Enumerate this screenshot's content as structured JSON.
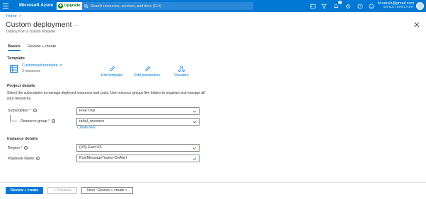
{
  "topbar": {
    "brand": "Microsoft Azure",
    "upgrade_label": "Upgrade",
    "search_placeholder": "Search resources, services, and docs (G+/)",
    "notification_count": "1",
    "user_email": "hi.rahulx@gmail.com",
    "user_directory": "DEFAULT DIRECTORY",
    "accent": "#0078d4"
  },
  "breadcrumb": {
    "home": "Home",
    "separator": ">"
  },
  "page": {
    "title": "Custom deployment",
    "more": "...",
    "subtitle": "Deploy from a custom template"
  },
  "tabs": [
    {
      "label": "Basics",
      "active": true
    },
    {
      "label": "Review + create",
      "active": false
    }
  ],
  "template": {
    "section_title": "Template",
    "link_text": "Customized template",
    "resource_count": "3 resources",
    "actions": [
      {
        "label": "Edit template",
        "icon": "pencil-icon"
      },
      {
        "label": "Edit parameters",
        "icon": "pencil-icon"
      },
      {
        "label": "Visualize",
        "icon": "visualize-icon"
      }
    ]
  },
  "project": {
    "section_title": "Project details",
    "description": "Select the subscription to manage deployed resources and costs. Use resource groups like folders to organize and manage all your resources.",
    "subscription_label": "Subscription",
    "subscription_value": "Free Trial",
    "resource_group_label": "Resource group",
    "resource_group_value": "rahul_resource",
    "create_new": "Create new"
  },
  "instance": {
    "section_title": "Instance details",
    "region_label": "Region",
    "region_value": "(US) East US",
    "playbook_label": "Playbook Name",
    "playbook_value": "PostMessageTeams-OnAlert"
  },
  "footer": {
    "review_create": "Review + create",
    "previous": "< Previous",
    "next": "Next : Review + create >"
  }
}
